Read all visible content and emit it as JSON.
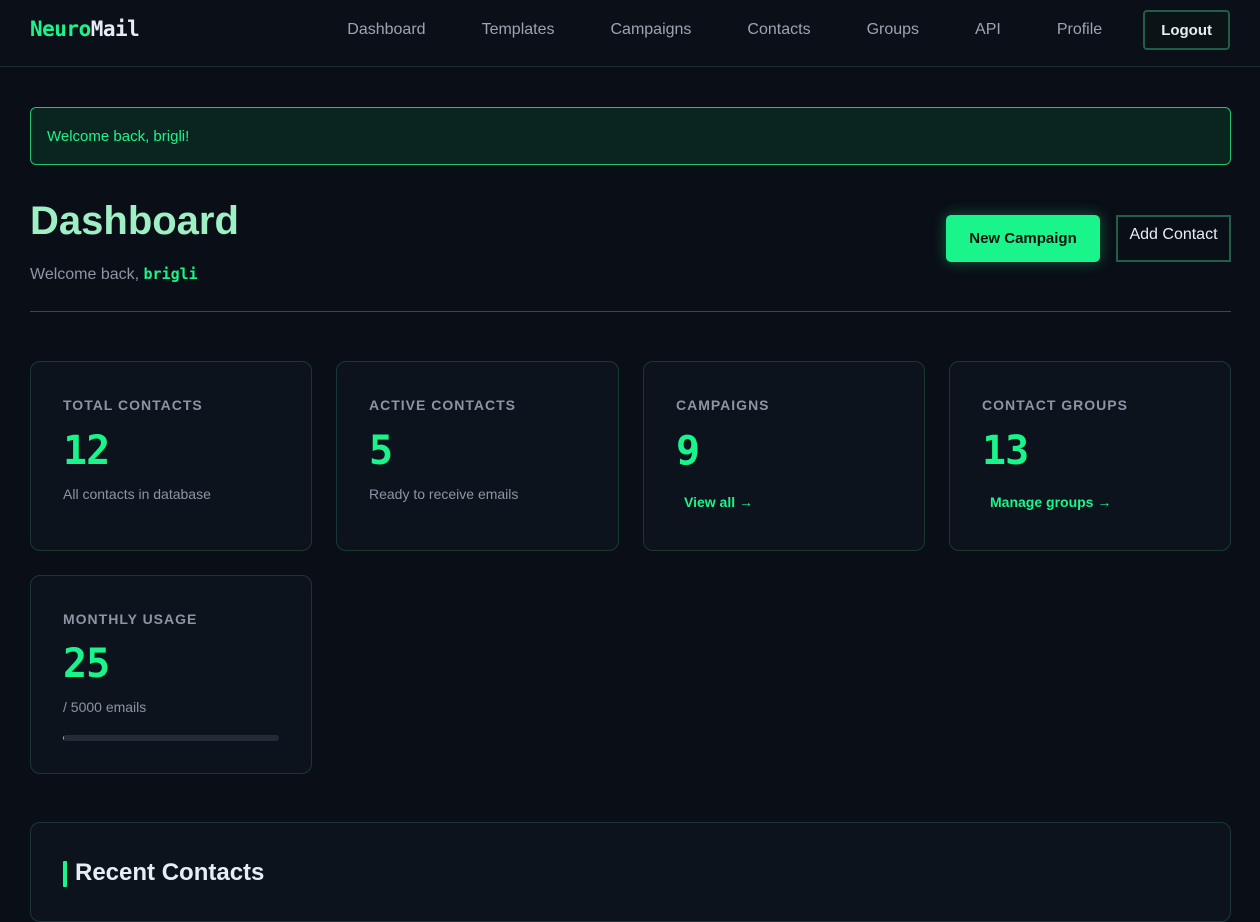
{
  "brand": {
    "part1": "Neuro",
    "part2": "Mail"
  },
  "nav": {
    "links": [
      "Dashboard",
      "Templates",
      "Campaigns",
      "Contacts",
      "Groups",
      "API",
      "Profile"
    ],
    "logout": "Logout"
  },
  "alert": {
    "message": "Welcome back, brigli!"
  },
  "header": {
    "title": "Dashboard",
    "welcome_prefix": "Welcome back,",
    "username": "brigli",
    "new_campaign": "New Campaign",
    "add_contact": "Add Contact"
  },
  "stats": {
    "total_contacts": {
      "label": "TOTAL CONTACTS",
      "value": "12",
      "sub": "All contacts in database"
    },
    "active_contacts": {
      "label": "ACTIVE CONTACTS",
      "value": "5",
      "sub": "Ready to receive emails"
    },
    "campaigns": {
      "label": "CAMPAIGNS",
      "value": "9",
      "link": "View all →"
    },
    "contact_groups": {
      "label": "CONTACT GROUPS",
      "value": "13",
      "link": "Manage groups →"
    },
    "monthly_usage": {
      "label": "MONTHLY USAGE",
      "value": "25",
      "sub": "/ 5000 emails",
      "progress": 0.005
    }
  },
  "recent": {
    "title": "Recent Contacts"
  },
  "colors": {
    "accent": "#19f58a",
    "background": "#0a0e17",
    "card": "#0d131c",
    "border": "#1a3832"
  }
}
